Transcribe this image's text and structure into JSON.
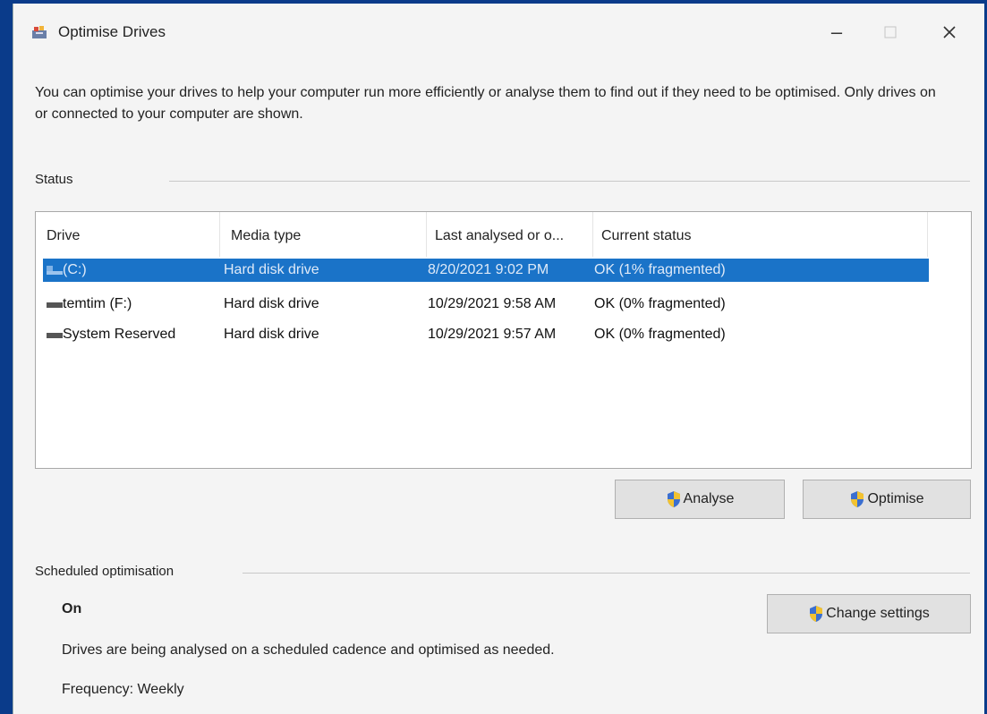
{
  "window": {
    "title": "Optimise Drives"
  },
  "description": "You can optimise your drives to help your computer run more efficiently or analyse them to find out if they need to be optimised. Only drives on or connected to your computer are shown.",
  "status": {
    "label": "Status",
    "columns": [
      "Drive",
      "Media type",
      "Last analysed or o...",
      "Current status"
    ],
    "drives": [
      {
        "name": "(C:)",
        "media": "Hard disk drive",
        "last": "8/20/2021 9:02 PM",
        "status": "OK (1% fragmented)",
        "selected": true
      },
      {
        "name": "temtim (F:)",
        "media": "Hard disk drive",
        "last": "10/29/2021 9:58 AM",
        "status": "OK (0% fragmented)",
        "selected": false
      },
      {
        "name": "System Reserved",
        "media": "Hard disk drive",
        "last": "10/29/2021 9:57 AM",
        "status": "OK (0% fragmented)",
        "selected": false
      }
    ]
  },
  "buttons": {
    "analyse": "Analyse",
    "optimise": "Optimise",
    "change_settings": "Change settings"
  },
  "scheduled": {
    "label": "Scheduled optimisation",
    "state": "On",
    "detail": "Drives are being analysed on a scheduled cadence and optimised as needed.",
    "frequency": "Frequency: Weekly"
  },
  "colors": {
    "selection": "#1a73c8",
    "background_frame": "#0a3b8a"
  }
}
